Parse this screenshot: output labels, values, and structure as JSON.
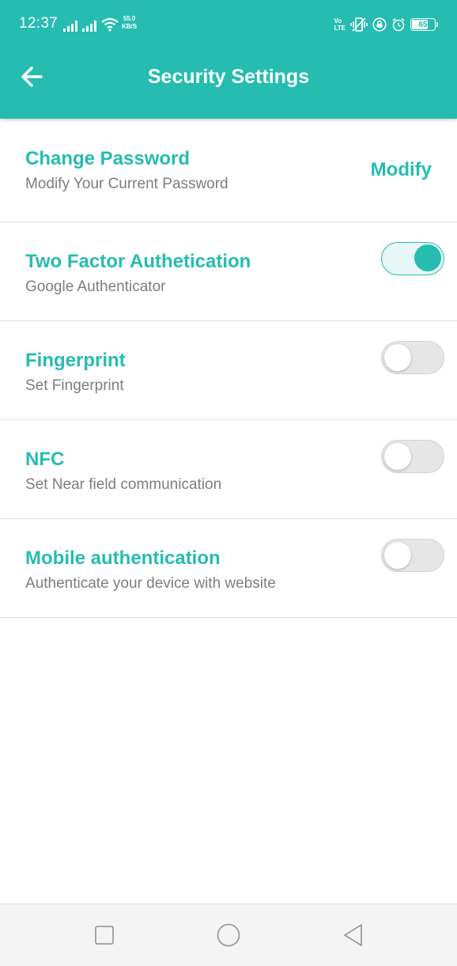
{
  "status_bar": {
    "time": "12:37",
    "net_speed_value": "55.0",
    "net_speed_unit": "KB/S",
    "volte_top": "Vo",
    "volte_bottom": "LTE",
    "battery_level": "65",
    "icons": [
      "signal-icon",
      "signal-icon",
      "wifi-icon",
      "vibrate-icon",
      "lock-icon",
      "alarm-icon",
      "battery-icon"
    ]
  },
  "header": {
    "title": "Security Settings",
    "back_icon": "arrow-left-icon"
  },
  "settings": {
    "items": [
      {
        "title": "Change Password",
        "subtitle": "Modify Your Current Password",
        "action_label": "Modify"
      },
      {
        "title": "Two Factor Authetication",
        "subtitle": "Google Authenticator",
        "enabled": true
      },
      {
        "title": "Fingerprint",
        "subtitle": "Set Fingerprint",
        "enabled": false
      },
      {
        "title": "NFC",
        "subtitle": "Set Near field communication",
        "enabled": false
      },
      {
        "title": "Mobile authentication",
        "subtitle": "Authenticate your device with website",
        "enabled": false
      }
    ]
  },
  "nav_bar": {
    "icons": [
      "recents-square-icon",
      "home-circle-icon",
      "back-triangle-icon"
    ]
  },
  "colors": {
    "accent": "#26bcb0",
    "subtitle": "#7d7d7d",
    "divider": "#dedede",
    "nav_background": "#f4f4f4"
  }
}
